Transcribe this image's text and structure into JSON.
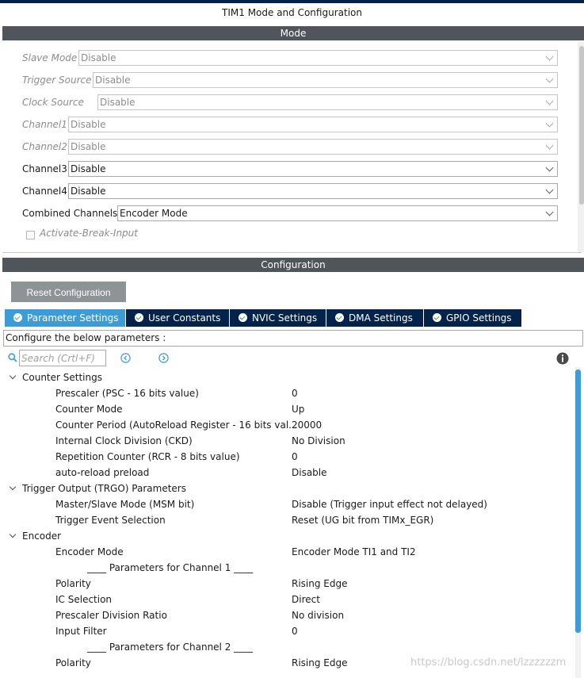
{
  "window": {
    "title": "TIM1 Mode and Configuration"
  },
  "mode_section": {
    "title": "Mode",
    "rows": [
      {
        "label": "Slave Mode",
        "value": "Disable",
        "disabled": true
      },
      {
        "label": "Trigger Source",
        "value": "Disable",
        "disabled": true
      },
      {
        "label": "Clock Source",
        "value": "Disable",
        "disabled": true
      },
      {
        "label": "Channel1",
        "value": "Disable",
        "disabled": true
      },
      {
        "label": "Channel2",
        "value": "Disable",
        "disabled": true
      },
      {
        "label": "Channel3",
        "value": "Disable",
        "disabled": false
      },
      {
        "label": "Channel4",
        "value": "Disable",
        "disabled": false
      },
      {
        "label": "Combined Channels",
        "value": "Encoder Mode",
        "disabled": false
      }
    ],
    "checkbox": {
      "label": "Activate-Break-Input",
      "checked": false,
      "disabled": true
    }
  },
  "config_section": {
    "title": "Configuration",
    "reset_button": "Reset Configuration",
    "tabs": [
      {
        "label": "Parameter Settings",
        "active": true
      },
      {
        "label": "User Constants",
        "active": false
      },
      {
        "label": "NVIC Settings",
        "active": false
      },
      {
        "label": "DMA Settings",
        "active": false
      },
      {
        "label": "GPIO Settings",
        "active": false
      }
    ],
    "configure_text": "Configure the below parameters :",
    "search": {
      "placeholder": "Search (Crtl+F)"
    },
    "tree": {
      "counter_settings": {
        "label": "Counter Settings",
        "params": [
          {
            "name": "Prescaler (PSC - 16 bits value)",
            "value": "0"
          },
          {
            "name": "Counter Mode",
            "value": "Up"
          },
          {
            "name": "Counter Period (AutoReload Register - 16 bits val...",
            "value": "20000"
          },
          {
            "name": "Internal Clock Division (CKD)",
            "value": "No Division"
          },
          {
            "name": "Repetition Counter (RCR - 8 bits value)",
            "value": "0"
          },
          {
            "name": "auto-reload preload",
            "value": "Disable"
          }
        ]
      },
      "trigger_output": {
        "label": "Trigger Output (TRGO) Parameters",
        "params": [
          {
            "name": "Master/Slave Mode (MSM bit)",
            "value": "Disable (Trigger input effect not delayed)"
          },
          {
            "name": "Trigger Event Selection",
            "value": "Reset (UG bit from TIMx_EGR)"
          }
        ]
      },
      "encoder": {
        "label": "Encoder",
        "encoder_mode": {
          "name": "Encoder Mode",
          "value": "Encoder Mode TI1 and TI2"
        },
        "channel1_header": "____ Parameters for Channel 1 ____",
        "channel1_params": [
          {
            "name": "Polarity",
            "value": "Rising Edge"
          },
          {
            "name": "IC Selection",
            "value": "Direct"
          },
          {
            "name": "Prescaler Division Ratio",
            "value": "No division"
          },
          {
            "name": "Input Filter",
            "value": "0"
          }
        ],
        "channel2_header": "____ Parameters for Channel 2 ____",
        "channel2_params": [
          {
            "name": "Polarity",
            "value": "Rising Edge"
          }
        ]
      }
    }
  },
  "watermark": "https://blog.csdn.net/lzzzzzzm",
  "colors": {
    "accent": "#3c9cd6",
    "tab_dark": "#03234b",
    "section_bar": "#50555c",
    "button_gray": "#8e9396"
  }
}
